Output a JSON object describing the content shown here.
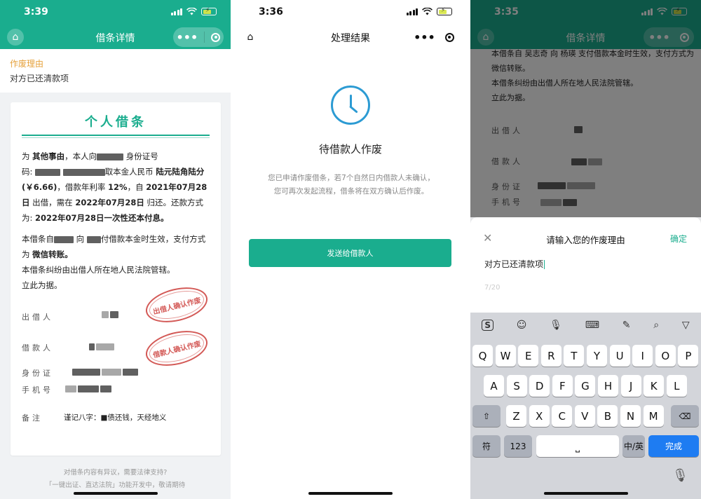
{
  "colors": {
    "brand": "#1aad8e",
    "stamp": "#c9302c",
    "clock": "#2c9bd3",
    "keyboard_accent": "#1e7cf2",
    "reason_label": "#e6a23c"
  },
  "panel1": {
    "status_time": "3:39",
    "nav_title": "借条详情",
    "reason_label": "作废理由",
    "reason_text": "对方已还清款项",
    "card_title": "个人借条",
    "para1": {
      "t1": "为 ",
      "purpose": "其他事由",
      "t2": "，本人向",
      "t3": " 身份证号",
      "t4": "码:",
      "t5": "取本金人民币 ",
      "amount_cn": "陆元陆角陆分",
      "amount_num": "(￥6.66)",
      "t6": "，借款年利率 ",
      "rate": "12%",
      "t7": "，自 ",
      "date_from": "2021年07月28日",
      "t8": " 出借，需在 ",
      "date_to": "2022年07月28日",
      "t9": " 归还。还款方式为: ",
      "repay": "2022年07月28日一次性还本付息。"
    },
    "para2": {
      "t1": "本借条自",
      "t2": " 向 ",
      "t3": "付借款本金时生效，支付方式为 ",
      "method": "微信转账。",
      "line2": "本借条纠纷由出借人所在地人民法院管辖。",
      "line3": "立此为据。"
    },
    "labels": {
      "lender": "出借人",
      "borrower": "借款人",
      "id_card": "身份证",
      "phone": "手机号",
      "remark": "备注"
    },
    "remark_value": "谨记八字：■债还钱，天经地义",
    "stamp_lender": "出借人确认作废",
    "stamp_borrower": "借款人确认作废",
    "footer_line1": "对借条内容有异议，需要法律支持?",
    "footer_line2": "「一键出证、直达法院」功能开发中，敬请期待"
  },
  "panel2": {
    "status_time": "3:36",
    "nav_title": "处理结果",
    "clock_icon": "clock-icon",
    "status_text": "待借款人作废",
    "description": "您已申请作废借条，若7个自然日内借款人未确认，您可再次发起流程，借条将在双方确认后作废。",
    "button_label": "发送给借款人"
  },
  "panel3": {
    "status_time": "3:35",
    "nav_title": "借条详情",
    "bg_line1": "本借条自 吴志奇 向 杨瑛 支付借款本金时生效，支付方式为 微信转账。",
    "bg_line2": "本借条纠纷由出借人所在地人民法院管辖。",
    "bg_line3": "立此为据。",
    "bg_labels": {
      "lender": "出借人",
      "borrower": "借款人",
      "id_card": "身份证",
      "phone": "手机号"
    },
    "sheet_title": "请输入您的作废理由",
    "sheet_confirm": "确定",
    "sheet_input": "对方已还清款项",
    "sheet_count": "7/20",
    "keyboard": {
      "row1": [
        "Q",
        "W",
        "E",
        "R",
        "T",
        "Y",
        "U",
        "I",
        "O",
        "P"
      ],
      "row2": [
        "A",
        "S",
        "D",
        "F",
        "G",
        "H",
        "J",
        "K",
        "L"
      ],
      "row3": [
        "Z",
        "X",
        "C",
        "V",
        "B",
        "N",
        "M"
      ],
      "sym": "符",
      "num": "123",
      "space_symbol": "⎵",
      "lang": "中/英",
      "done": "完成"
    }
  }
}
